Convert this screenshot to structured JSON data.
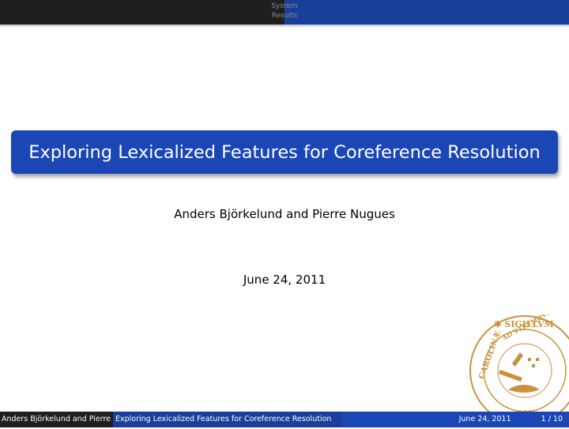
{
  "header": {
    "sections": [
      "System",
      "Results"
    ]
  },
  "title": "Exploring Lexicalized Features for Coreference Resolution",
  "author": "Anders Björkelund and Pierre Nugues",
  "date": "June 24, 2011",
  "footer": {
    "author": "Anders Björkelund and Pierre Nugues",
    "title": "Exploring Lexicalized Features for Coreference Resolution",
    "date": "June 24, 2011",
    "page": "1 / 10"
  },
  "seal": {
    "text_outer": "SIGILLVM UNIVERSITATIS CAROLINAE",
    "text_inner": "AD UTRUMQUE",
    "year": "1666"
  },
  "colors": {
    "primary": "#1a47b5",
    "header_dark": "#1f1f1f",
    "header_blue": "#1a3f9a",
    "seal": "#c9923a"
  }
}
